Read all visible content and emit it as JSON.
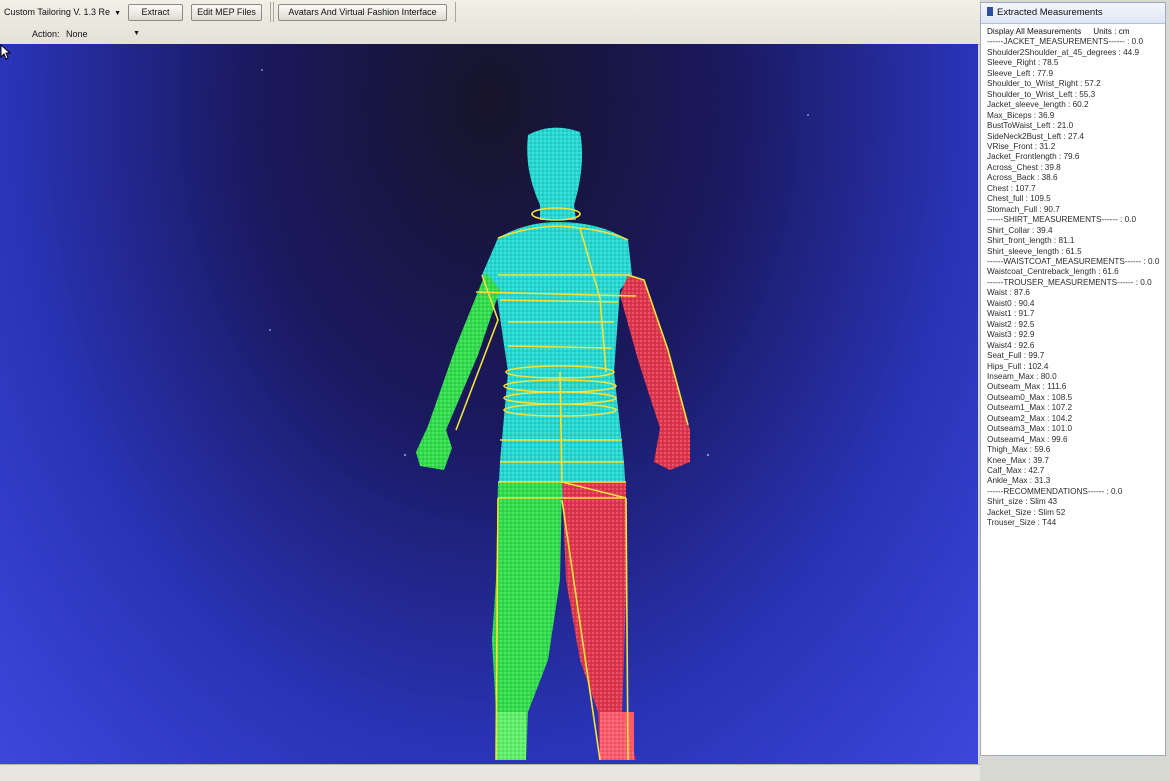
{
  "toolbar": {
    "app_version": "Custom Tailoring V. 1.3 Re",
    "extract_label": "Extract",
    "edit_mep_label": "Edit MEP Files",
    "avatars_label": "Avatars And Virtual Fashion Interface",
    "action_label": "Action:",
    "action_value": "None"
  },
  "panel": {
    "title": "Extracted Measurements",
    "display_label": "Display All Measurements",
    "units_label": "Units : cm",
    "lines": [
      "------JACKET_MEASUREMENTS------ : 0.0",
      "Shoulder2Shoulder_at_45_degrees : 44.9",
      "Sleeve_Right : 78.5",
      "Sleeve_Left : 77.9",
      "Shoulder_to_Wrist_Right : 57.2",
      "Shoulder_to_Wrist_Left : 55.3",
      "Jacket_sleeve_length : 60.2",
      "Max_Biceps : 36.9",
      "BustToWaist_Left : 21.0",
      "SideNeck2Bust_Left : 27.4",
      "VRise_Front : 31.2",
      "Jacket_Frontlength : 79.6",
      "Across_Chest : 39.8",
      "Across_Back : 38.6",
      "Chest : 107.7",
      "Chest_full : 109.5",
      "Stomach_Full : 90.7",
      "------SHIRT_MEASUREMENTS------ : 0.0",
      "Shirt_Collar : 39.4",
      "Shirt_front_length : 81.1",
      "Shirt_sleeve_length : 61.5",
      "------WAISTCOAT_MEASUREMENTS------ : 0.0",
      "Waistcoat_Centreback_length : 61.6",
      "------TROUSER_MEASUREMENTS------ : 0.0",
      "Waist : 87.6",
      "Waist0 : 90.4",
      "Waist1 : 91.7",
      "Waist2 : 92.5",
      "Waist3 : 92.9",
      "Waist4 : 92.6",
      "Seat_Full : 99.7",
      "Hips_Full : 102.4",
      "Inseam_Max : 80.0",
      "Outseam_Max : 111.6",
      "Outseam0_Max : 108.5",
      "Outseam1_Max : 107.2",
      "Outseam2_Max : 104.2",
      "Outseam3_Max : 101.0",
      "Outseam4_Max : 99.6",
      "Thigh_Max : 59.6",
      "Knee_Max : 39.7",
      "Calf_Max : 42.7",
      "Ankle_Max : 31.3",
      "------RECOMMENDATIONS------ : 0.0",
      "Shirt_size : Slim 43",
      "Jacket_Size : Slim 52",
      "Trouser_Size : T44"
    ]
  },
  "icons": {
    "dropdown": "chevron-down-icon",
    "window": "window-icon",
    "cursor": "mouse-cursor-icon"
  },
  "colors": {
    "viewport_top": "#17142a",
    "viewport_bottom": "#3c48dd",
    "body_cyan": "#22d8d0",
    "left_side_green": "#2fdc4a",
    "right_side_red": "#e0354d",
    "measure_line_yellow": "#f2e23a"
  }
}
